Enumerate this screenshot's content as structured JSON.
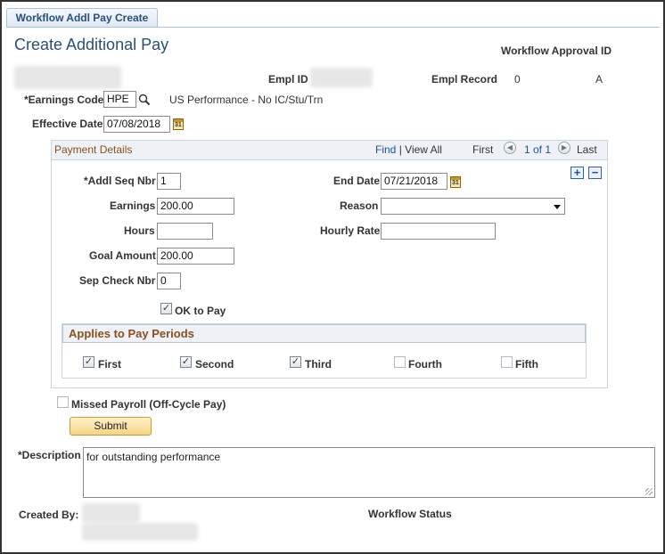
{
  "tab": {
    "label": "Workflow Addl Pay Create"
  },
  "page_title": "Create Additional Pay",
  "header": {
    "workflow_approval_id_label": "Workflow Approval ID",
    "empl_id_label": "Empl ID",
    "empl_record_label": "Empl Record",
    "empl_record_value": "0",
    "status_value": "A"
  },
  "earnings_code": {
    "label": "*Earnings Code",
    "value": "HPE",
    "description": "US Performance - No IC/Stu/Trn"
  },
  "effective_date": {
    "label": "Effective Date",
    "value": "07/08/2018"
  },
  "calendar_icon_text": "31",
  "payment_details": {
    "title": "Payment Details",
    "find_label": "Find",
    "separator": "|",
    "view_all_label": "View All",
    "first_label": "First",
    "range_label": "1 of 1",
    "last_label": "Last",
    "add_symbol": "+",
    "remove_symbol": "−",
    "prev_symbol": "◀",
    "next_symbol": "▶",
    "addl_seq_nbr": {
      "label": "*Addl Seq Nbr",
      "value": "1"
    },
    "end_date": {
      "label": "End Date",
      "value": "07/21/2018"
    },
    "earnings": {
      "label": "Earnings",
      "value": "200.00"
    },
    "reason": {
      "label": "Reason",
      "value": ""
    },
    "hours": {
      "label": "Hours",
      "value": ""
    },
    "hourly_rate": {
      "label": "Hourly Rate",
      "value": ""
    },
    "goal_amount": {
      "label": "Goal Amount",
      "value": "200.00"
    },
    "sep_check_nbr": {
      "label": "Sep Check Nbr",
      "value": "0"
    },
    "ok_to_pay": {
      "label": "OK to Pay",
      "checked": true
    }
  },
  "applies_to_pay_periods": {
    "title": "Applies to Pay Periods",
    "periods": [
      {
        "label": "First",
        "checked": true
      },
      {
        "label": "Second",
        "checked": true
      },
      {
        "label": "Third",
        "checked": true
      },
      {
        "label": "Fourth",
        "checked": false
      },
      {
        "label": "Fifth",
        "checked": false
      }
    ]
  },
  "check_mark": "✓",
  "missed_payroll": {
    "label": "Missed Payroll (Off-Cycle Pay)",
    "checked": false
  },
  "submit_label": "Submit",
  "description": {
    "label": "*Description",
    "value": "for outstanding performance"
  },
  "created_by_label": "Created By:",
  "workflow_status_label": "Workflow Status",
  "colors": {
    "title_blue": "#2b4f78",
    "group_title_brown": "#8a4f1d",
    "link_blue": "#1f4f9a",
    "submit_gold": "#f6d485"
  },
  "icons": [
    "lookup-magnifier-icon",
    "calendar-icon",
    "prev-row-icon",
    "next-row-icon",
    "add-row-icon",
    "remove-row-icon",
    "dropdown-arrow-icon",
    "resize-grip-icon"
  ]
}
